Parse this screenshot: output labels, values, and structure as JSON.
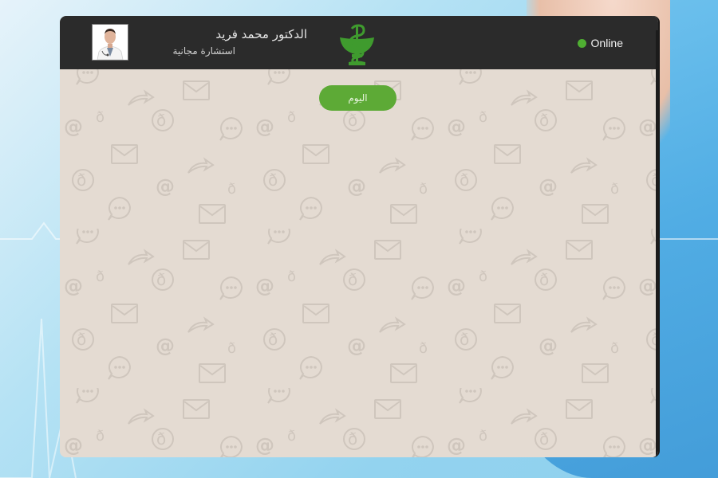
{
  "header": {
    "doctor_name": "الدكتور محمد فريد",
    "subtitle": "استشارة مجانية",
    "status_label": "Online",
    "status_color": "#4fae32"
  },
  "chat": {
    "date_divider": "اليوم"
  },
  "icons": {
    "logo": "pharmacy-caduceus-icon",
    "avatar": "doctor-avatar",
    "status": "online-dot-icon"
  },
  "colors": {
    "header_bg": "#2b2b2b",
    "chat_bg": "#e4dbd2",
    "accent_green": "#5daa36"
  }
}
